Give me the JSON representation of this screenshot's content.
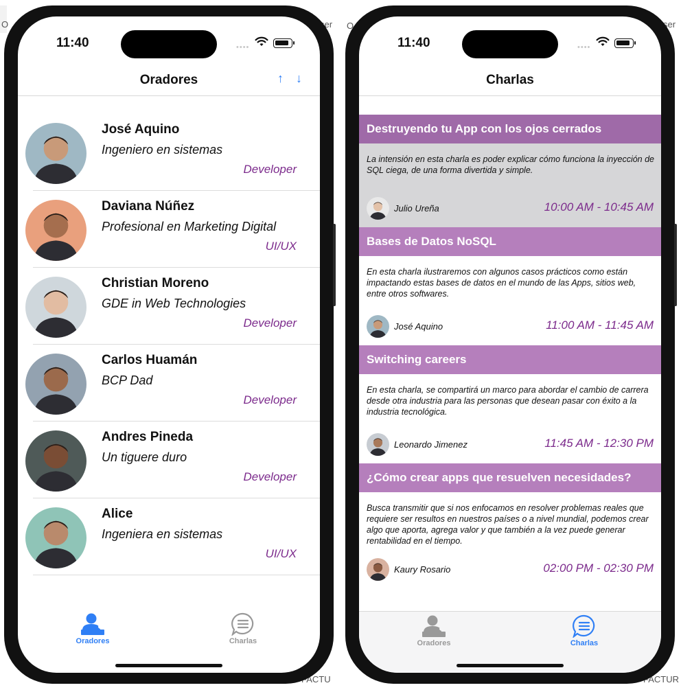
{
  "background": {
    "left_text": "O",
    "right_text_top": "ser",
    "right_text_top2": "O",
    "right_text_top3": "ser",
    "bottom_text": "FACTU",
    "bottom_text2": "FACTUR"
  },
  "left_phone": {
    "status": {
      "time": "11:40"
    },
    "nav": {
      "title": "Oradores",
      "sort_up": "↑",
      "sort_down": "↓"
    },
    "speakers": [
      {
        "name": "José Aquino",
        "title": "Ingeniero en sistemas",
        "role": "Developer",
        "skin": "#c89a79",
        "bg": "#9fb8c4"
      },
      {
        "name": "Daviana Núñez",
        "title": "Profesional en Marketing Digital",
        "role": "UI/UX",
        "skin": "#a56e4e",
        "bg": "#e9a07d"
      },
      {
        "name": "Christian Moreno",
        "title": "GDE in Web Technologies",
        "role": "Developer",
        "skin": "#e2bca2",
        "bg": "#cfd7dc"
      },
      {
        "name": "Carlos Huamán",
        "title": "BCP Dad",
        "role": "Developer",
        "skin": "#9b6a4c",
        "bg": "#93a2b0"
      },
      {
        "name": "Andres Pineda",
        "title": "Un tiguere duro",
        "role": "Developer",
        "skin": "#7a4d35",
        "bg": "#4f5a58"
      },
      {
        "name": "Alice",
        "title": "Ingeniera en sistemas",
        "role": "UI/UX",
        "skin": "#b98a6c",
        "bg": "#8fc4b7"
      }
    ],
    "tabs": {
      "speakers": "Oradores",
      "talks": "Charlas"
    },
    "colors": {
      "active": "#2f7ff5",
      "inactive": "#999999"
    }
  },
  "right_phone": {
    "status": {
      "time": "11:40"
    },
    "nav": {
      "title": "Charlas"
    },
    "talks": [
      {
        "title": "Destruyendo tu App con los ojos cerrados",
        "desc": "La intensión en esta charla es poder explicar cómo funciona la inyección de SQL ciega, de una forma divertida y simple.",
        "speaker": "Julio Ureña",
        "time": "10:00 AM - 10:45 AM"
      },
      {
        "title": "Bases de Datos NoSQL",
        "desc": " En esta charla ilustraremos con algunos casos prácticos como están impactando estas bases de datos en el mundo de las Apps, sitios web, entre otros softwares.",
        "speaker": "José Aquino",
        "time": "11:00 AM - 11:45 AM"
      },
      {
        "title": "Switching careers",
        "desc": "En esta charla, se compartirá un marco para abordar el cambio de carrera desde otra industria para las personas que desean pasar con éxito a la industria tecnológica.",
        "speaker": "Leonardo Jimenez",
        "time": "11:45 AM - 12:30 PM"
      },
      {
        "title": "¿Cómo crear apps que resuelven necesidades?",
        "desc": "Busca transmitir que si nos enfocamos en resolver problemas reales que requiere ser resultos en nuestros países o a nivel mundial, podemos crear algo que aporta, agrega valor y que también a la vez puede generar rentabilidad en el tiempo.",
        "speaker": "Kaury Rosario",
        "time": "02:00 PM - 02:30 PM"
      }
    ],
    "tabs": {
      "speakers": "Oradores",
      "talks": "Charlas"
    },
    "colors": {
      "header": "#b57fbc",
      "time": "#7c2b8c"
    }
  }
}
